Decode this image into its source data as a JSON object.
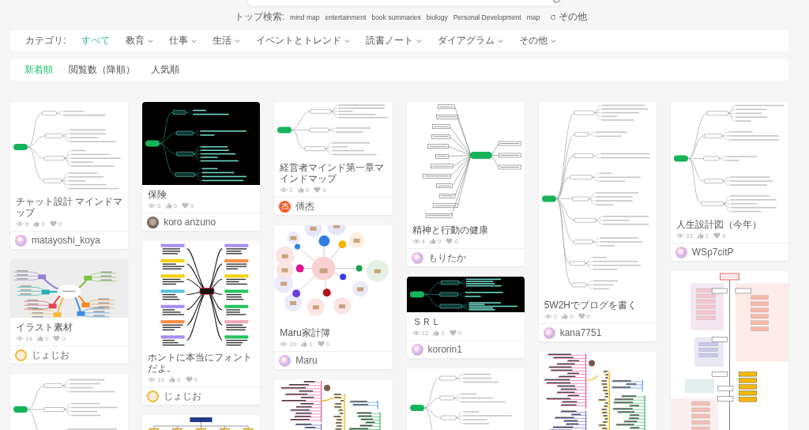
{
  "trending": {
    "label": "トップ検索:",
    "keywords": [
      "mind map",
      "entertainment",
      "book summaries",
      "biology",
      "Personal Development",
      "map"
    ],
    "more": "その他"
  },
  "categories": {
    "label": "カテゴリ:",
    "items": [
      {
        "label": "すべて",
        "selected": true,
        "dropdown": false
      },
      {
        "label": "教育",
        "selected": false,
        "dropdown": true
      },
      {
        "label": "仕事",
        "selected": false,
        "dropdown": true
      },
      {
        "label": "生活",
        "selected": false,
        "dropdown": true
      },
      {
        "label": "イベントとトレンド",
        "selected": false,
        "dropdown": true
      },
      {
        "label": "読書ノート",
        "selected": false,
        "dropdown": true
      },
      {
        "label": "ダイアグラム",
        "selected": false,
        "dropdown": true
      },
      {
        "label": "その他",
        "selected": false,
        "dropdown": true
      }
    ]
  },
  "sort_tabs": [
    {
      "label": "新着順",
      "selected": true
    },
    {
      "label": "閲覧数（降順）",
      "selected": false
    },
    {
      "label": "人気順",
      "selected": false
    }
  ],
  "columns": [
    {
      "cards": [
        {
          "thumbnail": {
            "kind": "tree"
          },
          "title": "チャット設計 マインドマップ",
          "views": "6",
          "likes": "0",
          "favorites": "0",
          "author": {
            "name": "matayoshi_koya",
            "avatar": {
              "kind": "gradient"
            }
          }
        },
        {
          "thumbnail": {
            "kind": "branches"
          },
          "title": "イラスト素材",
          "views": "14",
          "likes": "0",
          "favorites": "0",
          "author": {
            "name": "じょじお",
            "avatar": {
              "kind": "cartoon"
            }
          }
        },
        {
          "thumbnail": {
            "kind": "tree"
          }
        }
      ]
    },
    {
      "cards": [
        {
          "thumbnail": {
            "kind": "tree-dark"
          },
          "title": "保険",
          "views": "6",
          "likes": "0",
          "favorites": "0",
          "author": {
            "name": "koro anzuno",
            "avatar": {
              "kind": "photo"
            }
          }
        },
        {
          "thumbnail": {
            "kind": "burst"
          },
          "title": "ホントに本当にフォントだよ。",
          "views": "19",
          "likes": "0",
          "favorites": "0",
          "author": {
            "name": "じょじお",
            "avatar": {
              "kind": "cartoon"
            }
          }
        },
        {
          "thumbnail": {
            "kind": "hierarchy"
          }
        }
      ]
    },
    {
      "cards": [
        {
          "thumbnail": {
            "kind": "tree"
          },
          "title": "経営者マインド第一章マインドマップ",
          "views": "2",
          "likes": "0",
          "favorites": "0",
          "author": {
            "name": "傅杰",
            "avatar": {
              "kind": "letter",
              "letter": "杰"
            }
          }
        },
        {
          "thumbnail": {
            "kind": "bubbles"
          },
          "title": "Maru家計簿",
          "views": "20",
          "likes": "1",
          "favorites": "0",
          "author": {
            "name": "Maru",
            "avatar": {
              "kind": "gradient"
            }
          }
        },
        {
          "thumbnail": {
            "kind": "color-tree"
          }
        }
      ]
    },
    {
      "cards": [
        {
          "thumbnail": {
            "kind": "fan"
          },
          "title": "精神と行動の健康",
          "views": "4",
          "likes": "0",
          "favorites": "0",
          "author": {
            "name": "もりたか",
            "avatar": {
              "kind": "gradient"
            }
          }
        },
        {
          "thumbnail": {
            "kind": "tree-dark"
          },
          "title": "ＳＲＬ",
          "views": "12",
          "likes": "1",
          "favorites": "0",
          "author": {
            "name": "kororin1",
            "avatar": {
              "kind": "gradient"
            }
          }
        },
        {
          "thumbnail": {
            "kind": "tree"
          }
        }
      ]
    },
    {
      "cards": [
        {
          "thumbnail": {
            "kind": "tree"
          },
          "title": "5W2Hでブログを書く",
          "views": "2",
          "likes": "0",
          "favorites": "0",
          "author": {
            "name": "kana7751",
            "avatar": {
              "kind": "gradient"
            }
          }
        },
        {
          "thumbnail": {
            "kind": "color-tree"
          }
        }
      ]
    },
    {
      "cards": [
        {
          "thumbnail": {
            "kind": "tree"
          },
          "title": "人生設計図（今年）",
          "views": "33",
          "likes": "1",
          "favorites": "0",
          "author": {
            "name": "WSp7citP",
            "avatar": {
              "kind": "gradient"
            }
          }
        },
        {
          "thumbnail": {
            "kind": "org"
          }
        }
      ]
    }
  ]
}
